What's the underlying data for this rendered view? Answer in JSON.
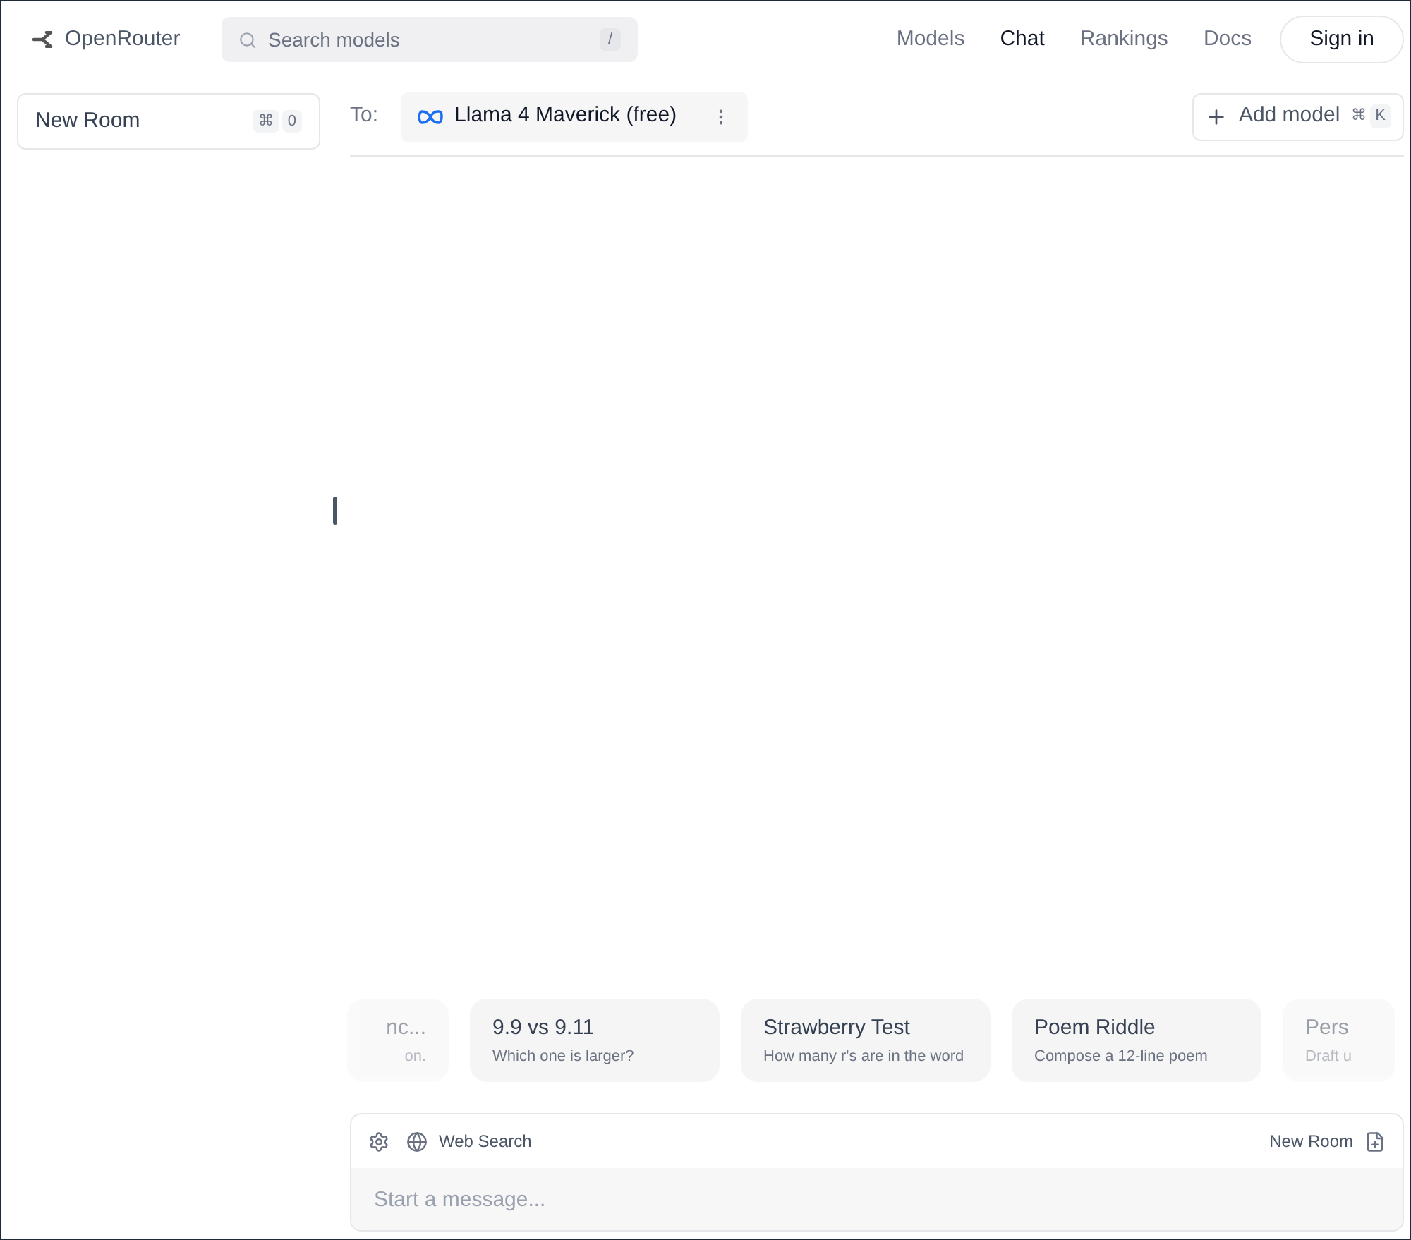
{
  "header": {
    "logo": "OpenRouter",
    "search": {
      "placeholder": "Search models",
      "shortcut": "/"
    },
    "nav": [
      {
        "label": "Models",
        "selected": false
      },
      {
        "label": "Chat",
        "selected": true
      },
      {
        "label": "Rankings",
        "selected": false
      },
      {
        "label": "Docs",
        "selected": false
      }
    ],
    "sign_in": "Sign in"
  },
  "sidebar": {
    "new_room": {
      "label": "New Room",
      "shortcut_modifier": "⌘",
      "shortcut_key": "0"
    }
  },
  "chat": {
    "to_label": "To:",
    "model": "Llama 4 Maverick (free)",
    "add_model": {
      "label": "Add model",
      "shortcut_modifier": "⌘",
      "shortcut_key": "K"
    },
    "suggestions": [
      {
        "title": "nc...",
        "subtitle": "on."
      },
      {
        "title": "9.9 vs 9.11",
        "subtitle": "Which one is larger?"
      },
      {
        "title": "Strawberry Test",
        "subtitle": "How many r's are in the word"
      },
      {
        "title": "Poem Riddle",
        "subtitle": "Compose a 12-line poem"
      },
      {
        "title": "Pers",
        "subtitle": "Draft u"
      }
    ],
    "composer": {
      "web_search": "Web Search",
      "new_room": "New Room",
      "placeholder": "Start a message..."
    }
  }
}
